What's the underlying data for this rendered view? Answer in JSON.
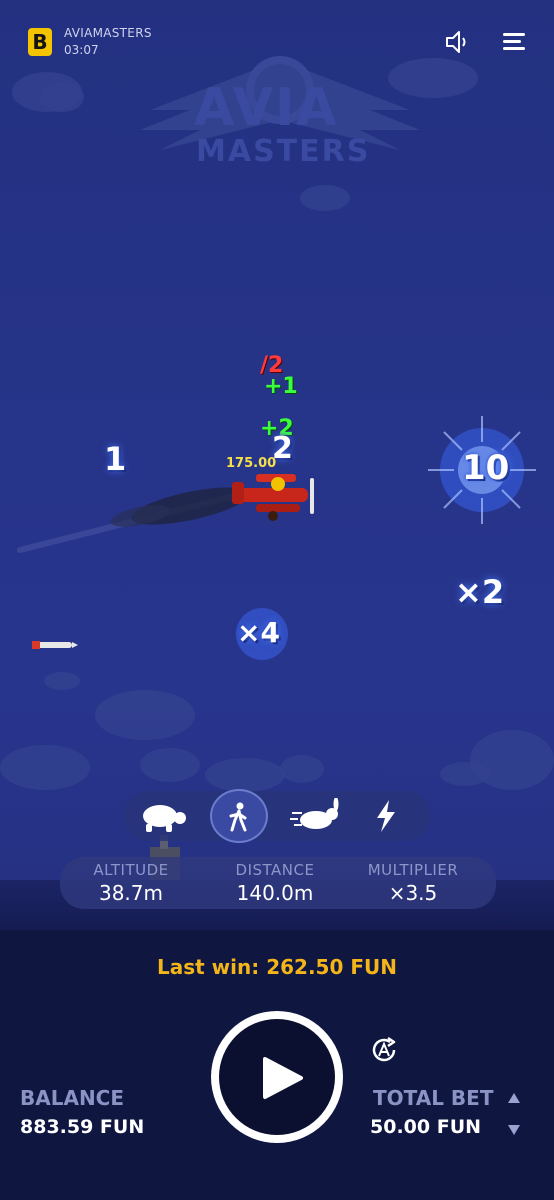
{
  "header": {
    "brand_letter": "B",
    "app_title": "AVIAMASTERS",
    "time": "03:07"
  },
  "watermark": {
    "line1": "AVIA",
    "line2": "MASTERS"
  },
  "game": {
    "multipliers": [
      "1",
      "10",
      "×2",
      "×4"
    ],
    "plane_badges": {
      "divide": "/2",
      "plus_one": "+1",
      "plus_two": "+2",
      "count": "2",
      "amount": "175.00"
    },
    "speed_modes": [
      "turtle",
      "walk",
      "rabbit",
      "lightning"
    ],
    "active_speed": "walk"
  },
  "stats": {
    "altitude_label": "ALTITUDE",
    "altitude_value": "38.7m",
    "distance_label": "DISTANCE",
    "distance_value": "140.0m",
    "multiplier_label": "MULTIPLIER",
    "multiplier_value": "×3.5"
  },
  "panel": {
    "last_win": "Last win: 262.50 FUN",
    "balance_label": "BALANCE",
    "balance_value": "883.59 FUN",
    "total_bet_label": "TOTAL BET",
    "total_bet_value": "50.00 FUN"
  },
  "colors": {
    "accent": "#f3b51a",
    "background": "#263489",
    "panel": "#0f1640"
  }
}
